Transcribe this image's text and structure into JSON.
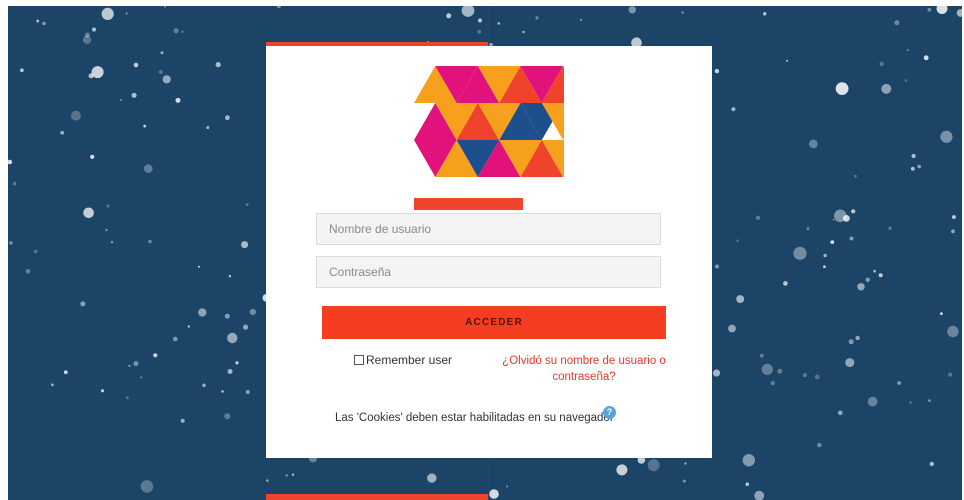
{
  "brand": {
    "logo_icon": "triangle-mosaic-logo-icon",
    "colors": [
      "#f7a01d",
      "#e2127d",
      "#f0432b",
      "#1c4f8c"
    ]
  },
  "login": {
    "username_placeholder": "Nombre de usuario",
    "password_placeholder": "Contraseña",
    "submit_label": "ACCEDER",
    "remember_label": "Remember user",
    "forgot_link": "¿Olvidó su nombre de usuario o contraseña?",
    "cookies_notice": "Las 'Cookies' deben estar habilitadas en su navegador",
    "help_icon": "help-circle-icon"
  },
  "theme": {
    "background": "#1b4467",
    "accent": "#f53d21",
    "link": "#e8372a"
  }
}
